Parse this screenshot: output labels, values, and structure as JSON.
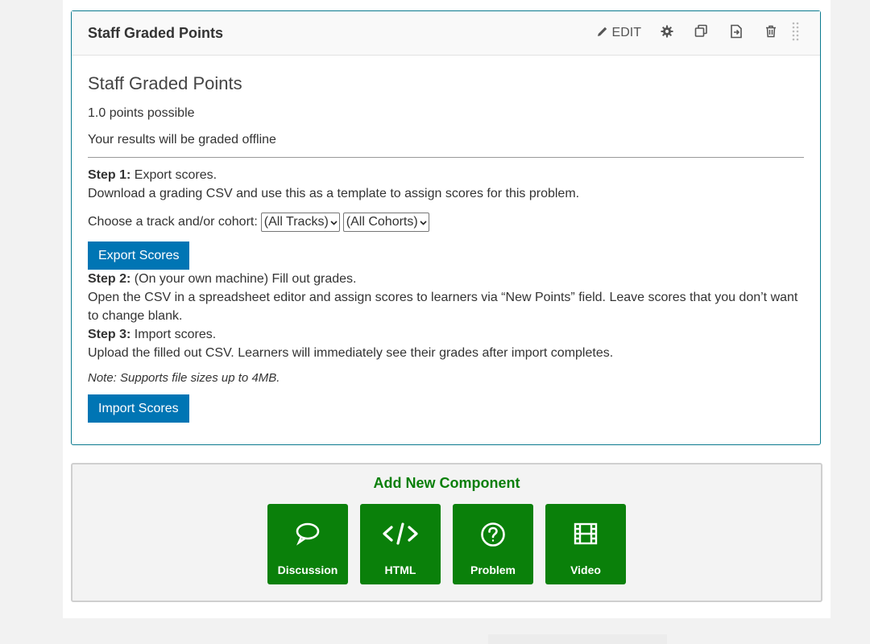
{
  "component": {
    "header_title": "Staff Graded Points",
    "edit_label": "EDIT",
    "problem_title": "Staff Graded Points",
    "points": "1.0 points possible",
    "graded_offline": "Your results will be graded offline",
    "step1_label": "Step 1:",
    "step1_text": "Export scores.",
    "step1_desc": "Download a grading CSV and use this as a template to assign scores for this problem.",
    "track_prompt": "Choose a track and/or cohort:",
    "track_select": "(All Tracks)",
    "cohort_select": "(All Cohorts)",
    "export_button": "Export Scores",
    "step2_label": "Step 2:",
    "step2_text": "(On your own machine) Fill out grades.",
    "step2_desc": "Open the CSV in a spreadsheet editor and assign scores to learners via “New Points” field. Leave scores that you don’t want to change blank.",
    "step3_label": "Step 3:",
    "step3_text": "Import scores.",
    "step3_desc": "Upload the filled out CSV. Learners will immediately see their grades after import completes.",
    "note": "Note: Supports file sizes up to 4MB.",
    "import_button": "Import Scores"
  },
  "add_component": {
    "title": "Add New Component",
    "tiles": [
      {
        "label": "Discussion",
        "icon": "speech-bubble-icon"
      },
      {
        "label": "HTML",
        "icon": "code-icon"
      },
      {
        "label": "Problem",
        "icon": "question-circle-icon"
      },
      {
        "label": "Video",
        "icon": "film-icon"
      }
    ]
  },
  "colors": {
    "accent_blue": "#0075b4",
    "border_teal": "#0a7a8f",
    "green": "#0a800a"
  }
}
